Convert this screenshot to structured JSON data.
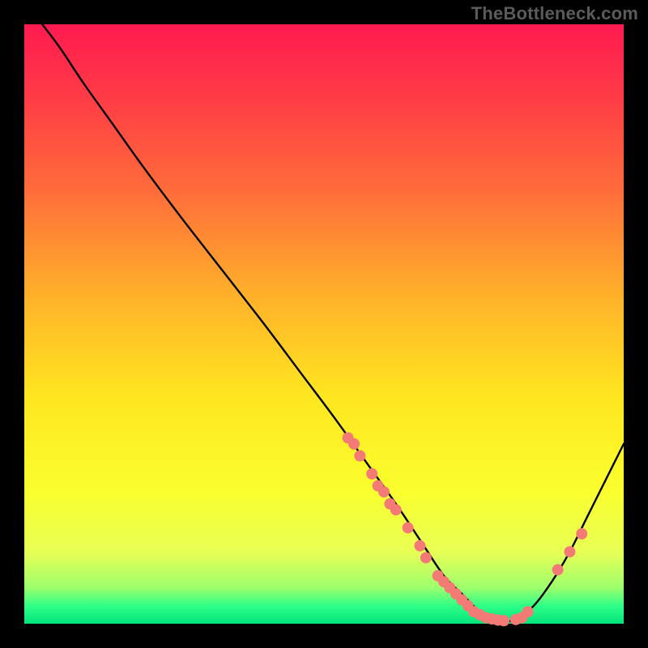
{
  "watermark": "TheBottleneck.com",
  "colors": {
    "background": "#000000",
    "curve": "#000000",
    "marker_fill": "#f37a75",
    "marker_stroke": "#f37a75",
    "gradient_top": "#ff1a50",
    "gradient_mid": "#ffe61f",
    "gradient_bottom": "#03e37c"
  },
  "chart_data": {
    "type": "line",
    "title": "",
    "xlabel": "",
    "ylabel": "",
    "xlim": [
      0,
      100
    ],
    "ylim": [
      0,
      100
    ],
    "grid": false,
    "legend": false,
    "series": [
      {
        "name": "curve",
        "x": [
          3,
          6,
          10,
          15,
          20,
          26,
          33,
          40,
          46,
          52,
          57,
          62,
          66,
          70,
          73,
          76,
          79,
          82,
          85,
          88,
          91,
          94,
          97,
          100
        ],
        "y": [
          100,
          96,
          90,
          83,
          76,
          68,
          59,
          50,
          42,
          34,
          27,
          20,
          14,
          8,
          5,
          2,
          0.5,
          0.7,
          3,
          7,
          12,
          18,
          24,
          30
        ]
      }
    ],
    "markers": [
      {
        "x": 54,
        "y": 31
      },
      {
        "x": 55,
        "y": 30
      },
      {
        "x": 56,
        "y": 28
      },
      {
        "x": 58,
        "y": 25
      },
      {
        "x": 59,
        "y": 23
      },
      {
        "x": 60,
        "y": 22
      },
      {
        "x": 61,
        "y": 20
      },
      {
        "x": 62,
        "y": 19
      },
      {
        "x": 64,
        "y": 16
      },
      {
        "x": 66,
        "y": 13
      },
      {
        "x": 67,
        "y": 11
      },
      {
        "x": 69,
        "y": 8
      },
      {
        "x": 70,
        "y": 7
      },
      {
        "x": 71,
        "y": 6
      },
      {
        "x": 72,
        "y": 5
      },
      {
        "x": 73,
        "y": 4
      },
      {
        "x": 74,
        "y": 3
      },
      {
        "x": 75,
        "y": 2
      },
      {
        "x": 76,
        "y": 1.5
      },
      {
        "x": 77,
        "y": 1
      },
      {
        "x": 78,
        "y": 0.8
      },
      {
        "x": 79,
        "y": 0.6
      },
      {
        "x": 80,
        "y": 0.5
      },
      {
        "x": 82,
        "y": 0.7
      },
      {
        "x": 83,
        "y": 1
      },
      {
        "x": 84,
        "y": 2
      },
      {
        "x": 89,
        "y": 9
      },
      {
        "x": 91,
        "y": 12
      },
      {
        "x": 93,
        "y": 15
      }
    ]
  }
}
